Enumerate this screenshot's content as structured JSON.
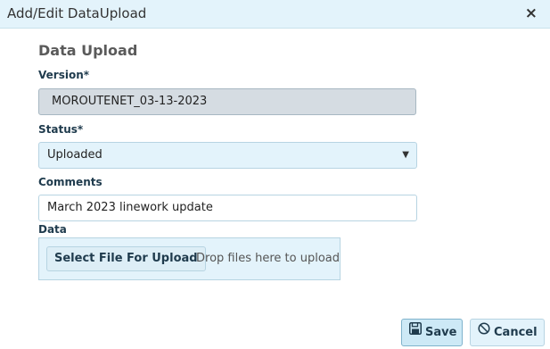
{
  "dialog": {
    "title": "Add/Edit DataUpload",
    "close_label": "×"
  },
  "form": {
    "section_title": "Data Upload",
    "version": {
      "label": "Version*",
      "value": "MOROUTENET_03-13-2023"
    },
    "status": {
      "label": "Status*",
      "value": "Uploaded"
    },
    "comments": {
      "label": "Comments",
      "value": "March 2023 linework update"
    },
    "data": {
      "label": "Data",
      "select_button": "Select File For Upload",
      "drop_hint": "Drop files here to upload"
    }
  },
  "actions": {
    "save_label": "Save",
    "cancel_label": "Cancel"
  },
  "icons": {
    "close": "close-icon",
    "dropdown": "chevron-down-icon",
    "save": "floppy-disk-icon",
    "cancel": "ban-icon"
  }
}
